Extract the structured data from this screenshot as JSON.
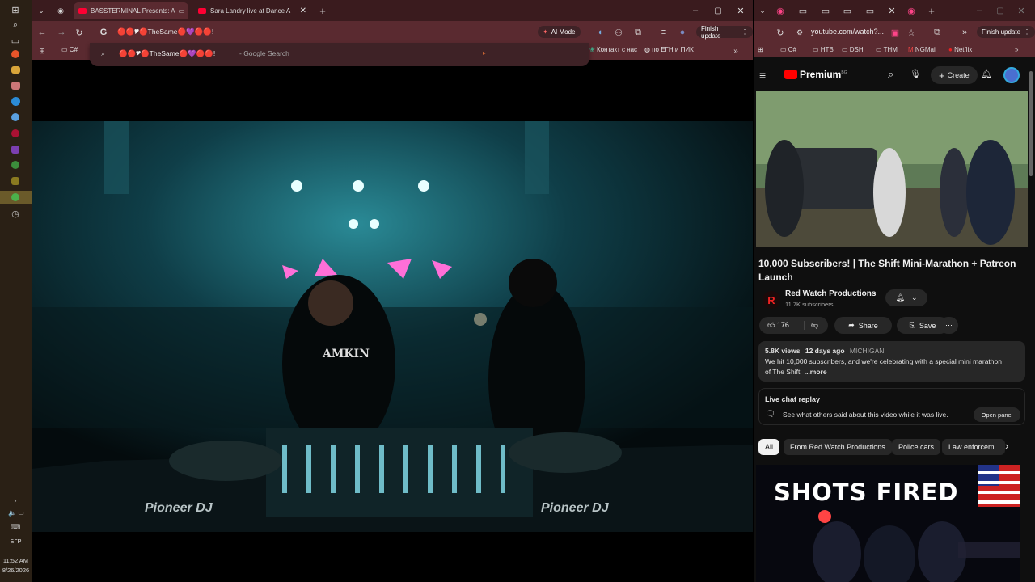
{
  "taskbar": {
    "lang": "БГР",
    "time": "11:52 AM",
    "date": "8/26/2026"
  },
  "left_browser": {
    "tabs": [
      {
        "title": "BASSTERMINAL Presents: A"
      },
      {
        "title": "Sara Landry live at Dance A"
      }
    ],
    "address_text": "🔴🔴🎔🔴TheSame🔴💜🔴🔴!",
    "ai_mode_label": "AI Mode",
    "finish_update_label": "Finish update",
    "bookmarks_folder": "C#",
    "omnibox_query": "🔴🔴🎔🔴TheSame🔴💜🔴🔴!",
    "omnibox_suffix": "- Google Search",
    "bookmark_contact": "Контакт с нас",
    "bookmark_egn": "по ЕГН и ПИК",
    "video_overlay": {
      "shirt_text": "AMKIN",
      "deck_left": "Pioneer DJ",
      "deck_right": "Pioneer DJ"
    }
  },
  "right_browser": {
    "url": "youtube.com/watch?...",
    "finish_update_label": "Finish update",
    "bookmarks": [
      "C#",
      "НТВ",
      "DSH",
      "THM",
      "NGMail",
      "Netflix"
    ],
    "yt": {
      "logo": "Premium",
      "logo_sup": "BG",
      "create_label": "Create",
      "video_title": "10,000 Subscribers! | The Shift Mini-Marathon + Patreon Launch",
      "channel_name": "Red Watch Productions",
      "subscribers": "11.7K subscribers",
      "likes": "176",
      "share_label": "Share",
      "save_label": "Save",
      "views": "5.8K views",
      "ago": "12 days ago",
      "location": "MICHIGAN",
      "desc_line1": "We hit 10,000 subscribers, and we're celebrating with a special mini marathon",
      "desc_line2": "of The Shift",
      "more_label": "...more",
      "live_chat_title": "Live chat replay",
      "live_chat_desc": "See what others said about this video while it was live.",
      "open_panel_label": "Open panel",
      "chips": [
        "All",
        "From Red Watch Productions",
        "Police cars",
        "Law enforcem"
      ],
      "thumb_text": "SHOTS FIRED"
    }
  }
}
